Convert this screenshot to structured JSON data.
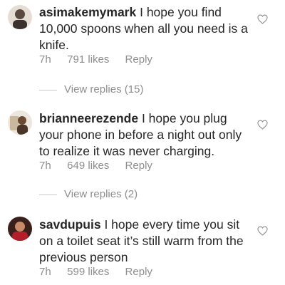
{
  "comments": [
    {
      "username": "asimakemymark",
      "text": "I hope you find 10,000 spoons when all you need is a knife.",
      "time": "7h",
      "likes": "791 likes",
      "reply_label": "Reply",
      "view_replies": "View replies (15)",
      "avatar_colors": [
        "#6b5a50",
        "#d9c8bb"
      ]
    },
    {
      "username": "brianneerezende",
      "text": "I hope you plug your phone in before a night out only to realize it was never charging.",
      "time": "7h",
      "likes": "649 likes",
      "reply_label": "Reply",
      "view_replies": "View replies (2)",
      "avatar_colors": [
        "#8a6a4a",
        "#e8e2d8"
      ]
    },
    {
      "username": "savdupuis",
      "text": "I hope every time you sit on a toilet seat it’s still warm from the previous person",
      "time": "7h",
      "likes": "599 likes",
      "reply_label": "Reply",
      "avatar_colors": [
        "#b31e2a",
        "#3a1f1a"
      ]
    }
  ],
  "icons": {
    "like": "heart-outline-icon"
  }
}
